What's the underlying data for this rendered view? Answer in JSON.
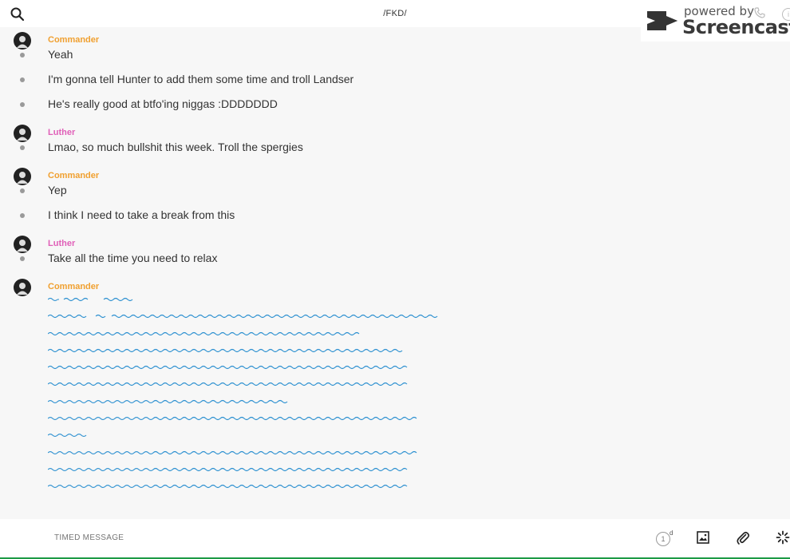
{
  "header": {
    "title": "/FKD/",
    "search_icon": "search-icon"
  },
  "watermark": {
    "line1": "powered by",
    "line2": "Screencastify",
    "info_glyph": "i"
  },
  "groups": [
    {
      "author": "Commander",
      "author_color": "#f0a030",
      "messages": [
        "Yeah",
        "I'm gonna tell Hunter to add them some time and troll Landser",
        "He's really good at btfo'ing niggas :DDDDDDD"
      ]
    },
    {
      "author": "Luther",
      "author_color": "#e060b8",
      "messages": [
        "Lmao, so much bullshit this week. Troll the spergies"
      ]
    },
    {
      "author": "Commander",
      "author_color": "#f0a030",
      "messages": [
        "Yep",
        "I think I need to take a break from this"
      ]
    },
    {
      "author": "Luther",
      "author_color": "#e060b8",
      "messages": [
        "Take all the time you need to relax"
      ]
    },
    {
      "author": "Commander",
      "author_color": "#f0a030",
      "messages": []
    }
  ],
  "composer": {
    "placeholder": "TIMED MESSAGE",
    "timer_value": "1",
    "timer_unit": "d"
  },
  "colors": {
    "scribble": "#2a8fd0",
    "accent_green": "#1d9a45"
  }
}
